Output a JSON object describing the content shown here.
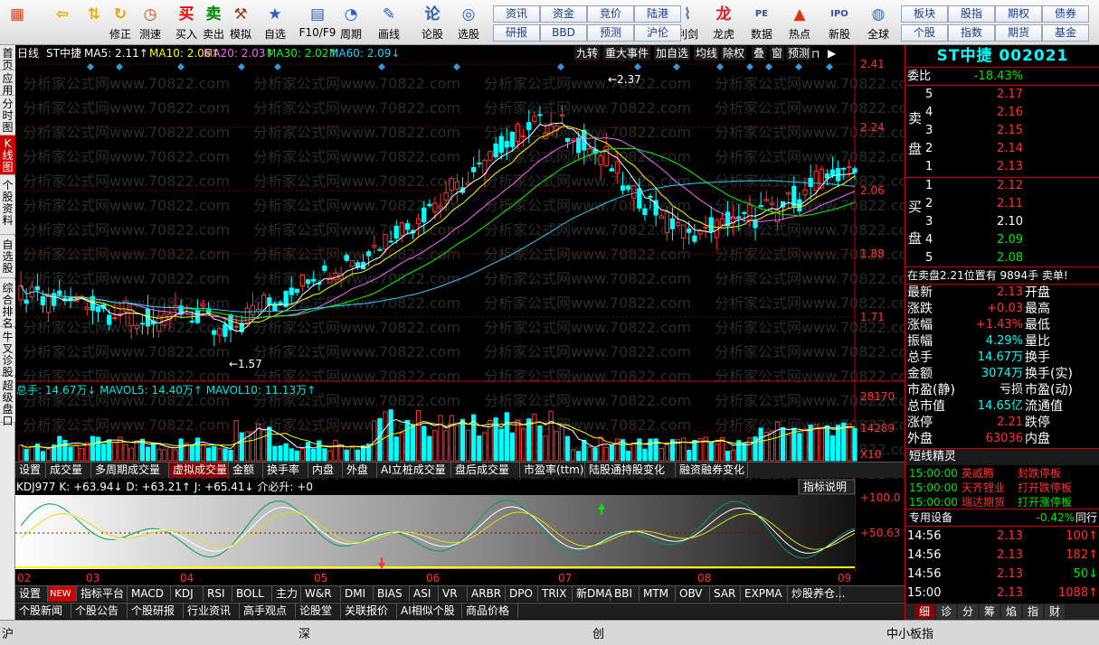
{
  "toolbar": {
    "buttons": [
      {
        "label": "",
        "icon": "grid-icon"
      },
      {
        "label": "",
        "icon": "back-icon"
      },
      {
        "label": "",
        "icon": "up-down-icon"
      },
      {
        "label": "修正",
        "icon": "refresh-icon"
      },
      {
        "label": "测速",
        "icon": "clock-icon"
      },
      {
        "label": "买入",
        "icon": "buy-icon"
      },
      {
        "label": "卖出",
        "icon": "sell-icon"
      },
      {
        "label": "模拟",
        "icon": "hammer-icon"
      },
      {
        "label": "自选",
        "icon": "folder-icon"
      },
      {
        "label": "F10/F9",
        "icon": "doc-icon"
      },
      {
        "label": "周期",
        "icon": "cycle-icon"
      },
      {
        "label": "画线",
        "icon": "pencil-icon"
      },
      {
        "label": "论股",
        "icon": "chat-icon"
      },
      {
        "label": "选股",
        "icon": "search-icon"
      },
      {
        "label": "利剑",
        "icon": "chart-icon"
      },
      {
        "label": "龙虎",
        "icon": "dragon-icon"
      },
      {
        "label": "数据",
        "icon": "pe-icon"
      },
      {
        "label": "热点",
        "icon": "hot-icon"
      },
      {
        "label": "新股",
        "icon": "ipo-icon"
      },
      {
        "label": "全球",
        "icon": "globe-icon"
      }
    ],
    "small": [
      {
        "label": "资讯"
      },
      {
        "label": "资金"
      },
      {
        "label": "竞价"
      },
      {
        "label": "陆港"
      },
      {
        "label": "研报"
      },
      {
        "label": "BBD"
      },
      {
        "label": "预测"
      },
      {
        "label": "沪伦"
      },
      {
        "label": "板块"
      },
      {
        "label": "股指"
      },
      {
        "label": "期权"
      },
      {
        "label": "债券"
      },
      {
        "label": "个股"
      },
      {
        "label": "指数"
      },
      {
        "label": "期货"
      },
      {
        "label": "基金"
      }
    ]
  },
  "lefttabs": [
    "首页",
    "应用",
    "分时图",
    "K线图",
    "个股资料",
    "自选股",
    "综合排名",
    "牛叉诊股",
    "超级盘口"
  ],
  "chart": {
    "period": "日线",
    "stock": "ST中捷",
    "ma": [
      {
        "label": "MA5: 2.11↑",
        "color": "#ffffff"
      },
      {
        "label": "MA10: 2.06↑",
        "color": "#ffff00"
      },
      {
        "label": "MA20: 2.03↑",
        "color": "#ff66ff"
      },
      {
        "label": "MA30: 2.02↑",
        "color": "#00ff00"
      },
      {
        "label": "MA60: 2.09↓",
        "color": "#33ccff"
      }
    ],
    "toolbtns": [
      "九转",
      "重大事件",
      "加自选",
      "均线",
      "除权",
      "叠",
      "窗",
      "预测"
    ],
    "price_axis": [
      "2.41",
      "2.24",
      "2.06",
      "1.88",
      "1.71"
    ],
    "high_label": "2.37",
    "low_label": "1.57",
    "watermark": "分析家公式网www.70822.com",
    "vol_title": "总手: 14.67万↓ MAVOL5: 14.40万↑ MAVOL10: 11.13万↑",
    "vol_axis": [
      "28170",
      "14289",
      "X10"
    ],
    "vol_tabs": [
      "设置",
      "成交量",
      "多周期成交量",
      "虚拟成交量",
      "金额",
      "换手率",
      "内盘",
      "外盘",
      "AI立桩成交量",
      "盘后成交量",
      "市盈率(ttm)",
      "陆股通持股变化",
      "融资融券变化"
    ],
    "kdj_title": "KDJ977 K: +63.94↓ D: +63.21↑ J: +65.41↓ 介必升: +0",
    "kdj_btn": "指标说明",
    "kdj_axis": [
      "+100.0",
      "+50.63"
    ],
    "months": [
      "02",
      "03",
      "04",
      "05",
      "06",
      "07",
      "08",
      "09"
    ],
    "indicator_tabs": [
      "设置",
      "NEW",
      "指标平台",
      "MACD",
      "KDJ",
      "RSI",
      "BOLL",
      "主力",
      "W&R",
      "DMI",
      "BIAS",
      "ASI",
      "VR",
      "ARBR",
      "DPO",
      "TRIX",
      "新DMA",
      "BBI",
      "MTM",
      "OBV",
      "SAR",
      "EXPMA",
      "炒股养仓..."
    ],
    "news_tabs": [
      "个股新闻",
      "个股公告",
      "个股研报",
      "行业资讯",
      "高手观点",
      "论股堂",
      "关联报价",
      "AI相似个股",
      "商品价格"
    ]
  },
  "quote": {
    "title": "ST中捷 002021",
    "webi_label": "委比",
    "webi_value": "-18.43%",
    "sell": [
      {
        "n": "5",
        "p": "2.17"
      },
      {
        "n": "4",
        "p": "2.16"
      },
      {
        "n": "3",
        "p": "2.15"
      },
      {
        "n": "2",
        "p": "2.14"
      },
      {
        "n": "1",
        "p": "2.13"
      }
    ],
    "buy": [
      {
        "n": "1",
        "p": "2.12"
      },
      {
        "n": "2",
        "p": "2.11"
      },
      {
        "n": "3",
        "p": "2.10"
      },
      {
        "n": "4",
        "p": "2.09"
      },
      {
        "n": "5",
        "p": "2.08"
      }
    ],
    "sell_label": [
      "卖",
      "盘"
    ],
    "buy_label": [
      "买",
      "盘"
    ],
    "alert": "在卖盘2.21位置有  9894手  卖单!",
    "stats": [
      {
        "l1": "最新",
        "v1": "2.13",
        "c1": "red",
        "l2": "开盘",
        "v2": ""
      },
      {
        "l1": "涨跌",
        "v1": "+0.03",
        "c1": "red",
        "l2": "最高",
        "v2": ""
      },
      {
        "l1": "涨幅",
        "v1": "+1.43%",
        "c1": "red",
        "l2": "最低",
        "v2": ""
      },
      {
        "l1": "振幅",
        "v1": "4.29%",
        "c1": "cyan",
        "l2": "量比",
        "v2": ""
      },
      {
        "l1": "总手",
        "v1": "14.67万",
        "c1": "cyan",
        "l2": "换手",
        "v2": ""
      },
      {
        "l1": "金额",
        "v1": "3074万",
        "c1": "cyan",
        "l2": "换手(实)",
        "v2": ""
      },
      {
        "l1": "市盈(静)",
        "v1": "亏损",
        "c1": "white",
        "l2": "市盈(动)",
        "v2": ""
      },
      {
        "l1": "总市值",
        "v1": "14.65亿",
        "c1": "cyan",
        "l2": "流通值",
        "v2": ""
      },
      {
        "l1": "涨停",
        "v1": "2.21",
        "c1": "red",
        "l2": "跌停",
        "v2": ""
      },
      {
        "l1": "外盘",
        "v1": "63036",
        "c1": "red",
        "l2": "内盘",
        "v2": ""
      }
    ],
    "short_title": "短线精灵",
    "short": [
      {
        "t": "15:00:00",
        "name": "英威腾",
        "evt": "封跌停板",
        "c": "red"
      },
      {
        "t": "15:00:00",
        "name": "天齐锂业",
        "evt": "打开跌停板",
        "c": "red"
      },
      {
        "t": "15:00:00",
        "name": "瑞达期货",
        "evt": "打开涨停板",
        "c": "green"
      }
    ],
    "sector_label": "专用设备",
    "sector_pct": "-0.42%",
    "sector_more": "同行",
    "ticks": [
      {
        "t": "14:56",
        "p": "2.13",
        "v": "100",
        "c": "red"
      },
      {
        "t": "14:56",
        "p": "2.13",
        "v": "182",
        "c": "red"
      },
      {
        "t": "14:56",
        "p": "2.13",
        "v": "50",
        "c": "green"
      },
      {
        "t": "15:00",
        "p": "2.13",
        "v": "1088",
        "c": "red"
      }
    ],
    "bottom_tabs": [
      "细",
      "诊",
      "分",
      "筹",
      "焰",
      "指",
      "财"
    ]
  },
  "status": {
    "sh": "沪",
    "sz": "深",
    "cy": "创",
    "zxb": "中小板指"
  }
}
